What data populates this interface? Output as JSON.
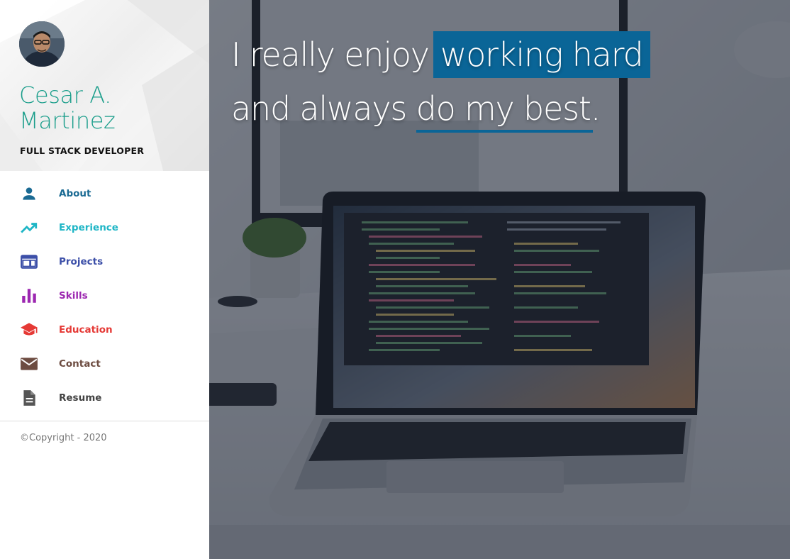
{
  "profile": {
    "name_line1": "Cesar A.",
    "name_line2": "Martinez",
    "role": "FULL STACK DEVELOPER",
    "avatar_icon": "avatar-photo"
  },
  "nav": {
    "items": [
      {
        "label": "About",
        "icon": "person-icon",
        "color": "#1a6a93"
      },
      {
        "label": "Experience",
        "icon": "trending-up-icon",
        "color": "#1fb6c6"
      },
      {
        "label": "Projects",
        "icon": "web-icon",
        "color": "#3c4fa8"
      },
      {
        "label": "Skills",
        "icon": "bar-chart-icon",
        "color": "#9c27b0"
      },
      {
        "label": "Education",
        "icon": "school-icon",
        "color": "#e53935"
      },
      {
        "label": "Contact",
        "icon": "mail-icon",
        "color": "#6d4c41"
      },
      {
        "label": "Resume",
        "icon": "document-icon",
        "color": "#555555"
      }
    ]
  },
  "footer": {
    "copyright": "©Copyright - 2020"
  },
  "hero": {
    "line1_prefix": "I really enjoy",
    "line1_highlight": "working hard",
    "line2_prefix": "and always",
    "line2_underlined": "do my best."
  },
  "colors": {
    "accent": "#0a6597",
    "name": "#1b9e8b"
  }
}
